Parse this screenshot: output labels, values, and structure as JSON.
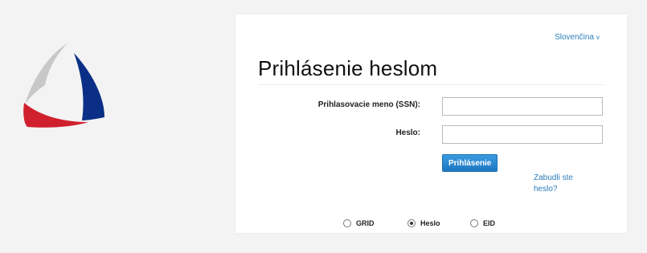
{
  "language": {
    "label": "Slovenčina",
    "chevron": "v"
  },
  "title": "Prihlásenie heslom",
  "form": {
    "username_label": "Prihlasovacie meno (SSN):",
    "username_value": "",
    "password_label": "Heslo:",
    "password_value": "",
    "submit_label": "Prihlásenie",
    "forgot_password": "Zabudli ste heslo?"
  },
  "login_methods": {
    "options": [
      "GRID",
      "Heslo",
      "EID"
    ],
    "selected": "Heslo"
  },
  "colors": {
    "accent": "#2b7dbb",
    "button": "#1d78c1",
    "logo_red": "#d0202e",
    "logo_blue": "#0b2f86",
    "logo_gray": "#c8c8c8"
  }
}
